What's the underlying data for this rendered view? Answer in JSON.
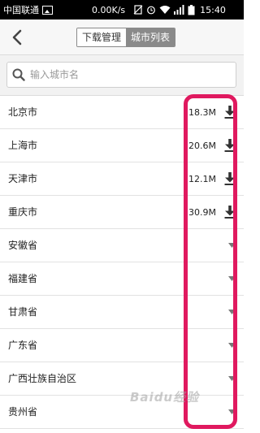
{
  "status_bar": {
    "carrier": "中国联通",
    "speed": "0.00K/s",
    "time": "15:40"
  },
  "header": {
    "tabs": [
      {
        "label": "下载管理",
        "active": false
      },
      {
        "label": "城市列表",
        "active": true
      }
    ]
  },
  "search": {
    "placeholder": "输入城市名"
  },
  "cities": [
    {
      "name": "北京市",
      "size": "18.3M",
      "action": "download"
    },
    {
      "name": "上海市",
      "size": "20.6M",
      "action": "download"
    },
    {
      "name": "天津市",
      "size": "12.1M",
      "action": "download"
    },
    {
      "name": "重庆市",
      "size": "30.9M",
      "action": "download"
    },
    {
      "name": "安徽省",
      "size": "",
      "action": "expand"
    },
    {
      "name": "福建省",
      "size": "",
      "action": "expand"
    },
    {
      "name": "甘肃省",
      "size": "",
      "action": "expand"
    },
    {
      "name": "广东省",
      "size": "",
      "action": "expand"
    },
    {
      "name": "广西壮族自治区",
      "size": "",
      "action": "expand"
    },
    {
      "name": "贵州省",
      "size": "",
      "action": "expand"
    }
  ],
  "colors": {
    "highlight": "#e0195f",
    "segment_active": "#8a8a8a"
  },
  "watermark": "Baidu经验"
}
